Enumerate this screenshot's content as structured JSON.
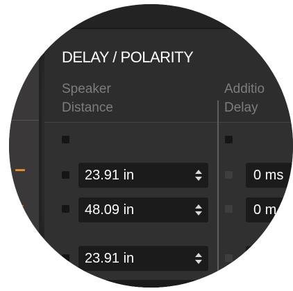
{
  "panel": {
    "title": "DELAY / POLARITY"
  },
  "columns": {
    "speaker_distance": "Speaker\nDistance",
    "additional_delay": "Additio\nDelay"
  },
  "speaker_distance_fields": [
    {
      "value": "23.91 in"
    },
    {
      "value": "48.09 in"
    },
    {
      "value": "23.91 in"
    },
    {
      "value": ""
    }
  ],
  "additional_delay_fields": [
    {
      "value": "0 ms"
    },
    {
      "value": "0 m"
    },
    {
      "value": ""
    }
  ],
  "icons": {
    "stepper": "up-down-stepper-icon",
    "channel_led": "channel-led-icon"
  },
  "colors": {
    "accent": "#e38a2a",
    "field_bg": "#1b1b1b",
    "label": "#7d7d80"
  }
}
